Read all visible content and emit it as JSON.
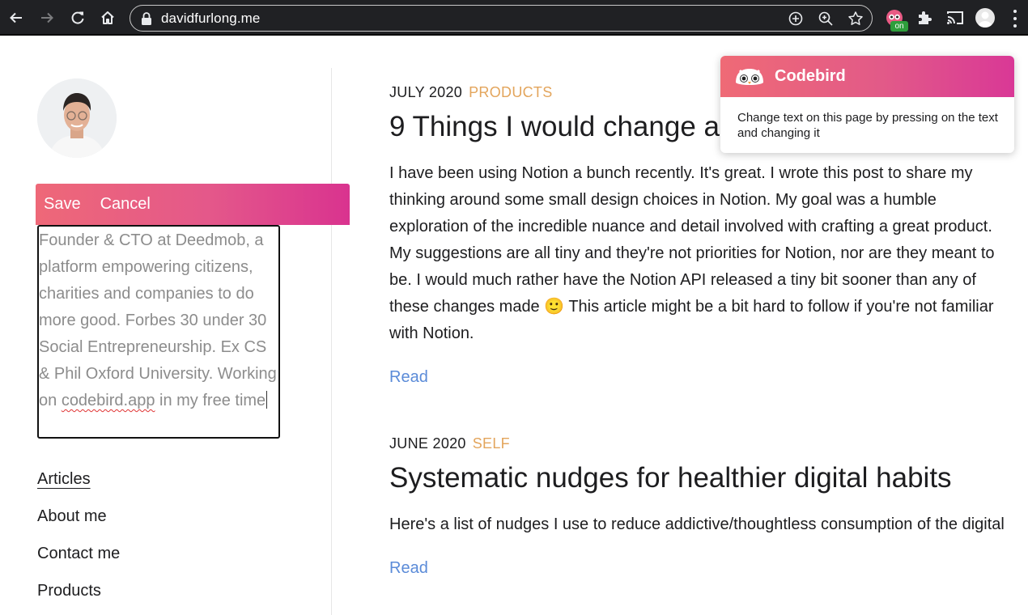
{
  "browser": {
    "url": "davidfurlong.me",
    "extension_badge": "on"
  },
  "sidebar": {
    "edit_actions": {
      "save": "Save",
      "cancel": "Cancel"
    },
    "bio": {
      "before": "Founder & CTO at Deedmob, a platform empowering citizens, charities and companies to do more good. Forbes 30 under 30 Social Entrepreneurship. Ex CS & Phil Oxford University. Working on ",
      "link": "codebird.app",
      "after": " in my free time"
    },
    "nav": [
      {
        "label": "Articles",
        "active": true
      },
      {
        "label": "About me",
        "active": false
      },
      {
        "label": "Contact me",
        "active": false
      },
      {
        "label": "Products",
        "active": false
      }
    ]
  },
  "articles": [
    {
      "date": "JULY 2020",
      "category": "PRODUCTS",
      "title": "9 Things I would change a",
      "excerpt": "I have been using Notion a bunch recently. It's great. I wrote this post to share my thinking around some small design choices in Notion. My goal was a humble exploration of the incredible nuance and detail involved with crafting a great product. My suggestions are all tiny and they're not priorities for Notion, nor are they meant to be. I would much rather have the Notion API released a tiny bit sooner than any of these changes made 🙂 This article might be a bit hard to follow if you're not familiar with Notion.",
      "read": "Read"
    },
    {
      "date": "JUNE 2020",
      "category": "SELF",
      "title": "Systematic nudges for healthier digital habits",
      "excerpt": "Here's a list of nudges I use to reduce addictive/thoughtless consumption of the digital",
      "read": "Read"
    }
  ],
  "popup": {
    "name": "Codebird",
    "message": "Change text on this page by pressing on the text and changing it"
  },
  "colors": {
    "accent_gradient_start": "#ee6878",
    "accent_gradient_end": "#d9338f",
    "category": "#e3a55c",
    "link": "#5b8bd8"
  },
  "icons": [
    "back-icon",
    "forward-icon",
    "reload-icon",
    "home-icon",
    "lock-icon",
    "add-icon",
    "zoom-icon",
    "star-icon",
    "codebird-extension-icon",
    "puzzle-icon",
    "cast-icon",
    "profile-icon",
    "menu-icon"
  ]
}
